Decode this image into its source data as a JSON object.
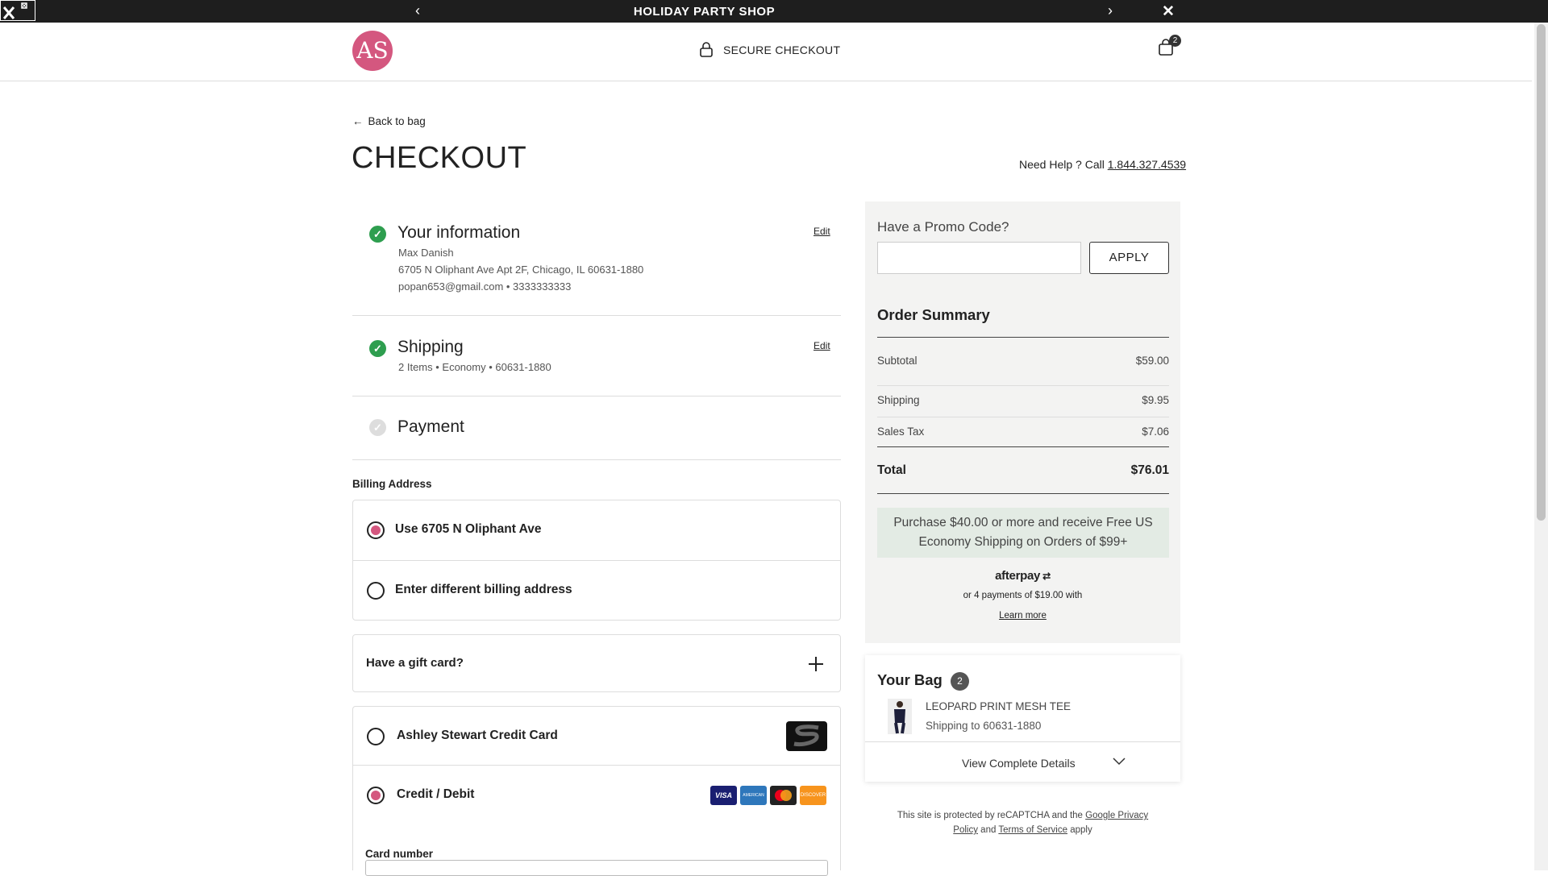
{
  "topbar": {
    "title": "HOLIDAY PARTY SHOP"
  },
  "header": {
    "logo_text": "AS",
    "secure_label": "SECURE CHECKOUT",
    "bag_count": "2"
  },
  "page": {
    "back_label": "Back to bag",
    "title": "CHECKOUT",
    "help_prefix": "Need Help ? Call",
    "help_phone": "1.844.327.4539"
  },
  "steps": {
    "info": {
      "heading": "Your information",
      "edit": "Edit",
      "name": "Max Danish",
      "address": "6705 N Oliphant Ave Apt 2F, Chicago, IL 60631-1880",
      "contact": "popan653@gmail.com • 3333333333"
    },
    "shipping": {
      "heading": "Shipping",
      "edit": "Edit",
      "summary": "2 Items • Economy • 60631-1880"
    },
    "payment": {
      "heading": "Payment"
    }
  },
  "billing": {
    "label": "Billing Address",
    "options": [
      {
        "label": "Use 6705 N Oliphant Ave",
        "selected": true
      },
      {
        "label": "Enter different billing address",
        "selected": false
      }
    ]
  },
  "gift_card": {
    "label": "Have a gift card?"
  },
  "payment_methods": [
    {
      "label": "Ashley Stewart Credit Card",
      "selected": false
    },
    {
      "label": "Credit / Debit",
      "selected": true
    }
  ],
  "card_logos": [
    "VISA",
    "AMEX",
    "MC",
    "DISCOVER"
  ],
  "card_number": {
    "label": "Card number"
  },
  "promo": {
    "title": "Have a Promo Code?",
    "input_value": "",
    "apply_label": "APPLY"
  },
  "order_summary": {
    "title": "Order Summary",
    "rows": [
      {
        "label": "Subtotal",
        "value": "$59.00"
      },
      {
        "label": "Shipping",
        "value": "$9.95"
      },
      {
        "label": "Sales Tax",
        "value": "$7.06"
      }
    ],
    "total_label": "Total",
    "total_value": "$76.01",
    "banner_line1": "Purchase $40.00 or more and receive Free US",
    "banner_line2": "Economy Shipping on Orders of $99+",
    "afterpay_brand": "afterpay",
    "afterpay_text": "or 4 payments of $19.00 with",
    "learn_more": "Learn more"
  },
  "your_bag": {
    "title": "Your Bag",
    "count": "2",
    "item_name": "LEOPARD PRINT MESH TEE",
    "item_shipping": "Shipping to 60631-1880",
    "details_label": "View Complete Details"
  },
  "recaptcha": {
    "text1": "This site is protected by reCAPTCHA and the",
    "link1": "Google Privacy",
    "link2": "Policy",
    "and": "and",
    "link3": "Terms of Service",
    "apply": "apply"
  },
  "colors": {
    "accent": "#d4577f",
    "success": "#2e9e4f",
    "topbar": "#1e1e1e"
  }
}
